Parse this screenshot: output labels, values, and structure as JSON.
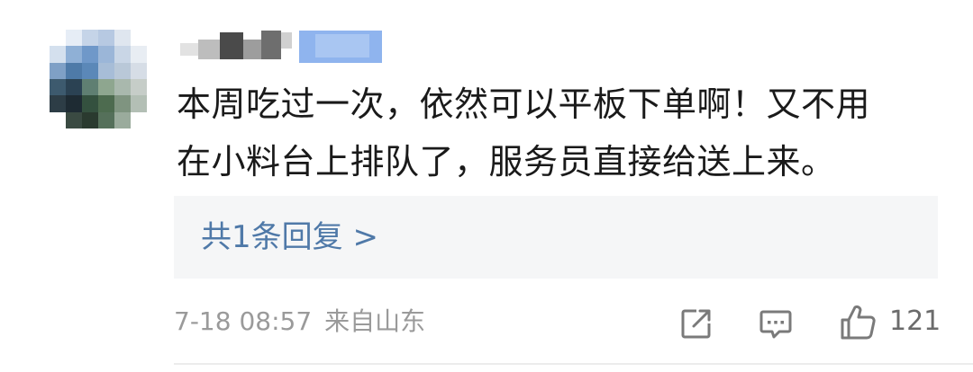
{
  "comment": {
    "lines": [
      "本周吃过一次，依然可以平板下单啊！又不用",
      "在小料台上排队了，服务员直接给送上来。"
    ]
  },
  "reply": {
    "label": "共1条回复 >"
  },
  "meta": {
    "date": "7-18 08:57",
    "location": "来自山东"
  },
  "actions": {
    "like_count": "121",
    "share_icon": "share-icon",
    "reply_icon": "comment-icon",
    "like_icon": "thumbs-up-icon"
  },
  "colors": {
    "text": "#1a1a1a",
    "link": "#4f79a8",
    "meta": "#9a9a9a",
    "reply_bg": "#f5f6f7"
  }
}
